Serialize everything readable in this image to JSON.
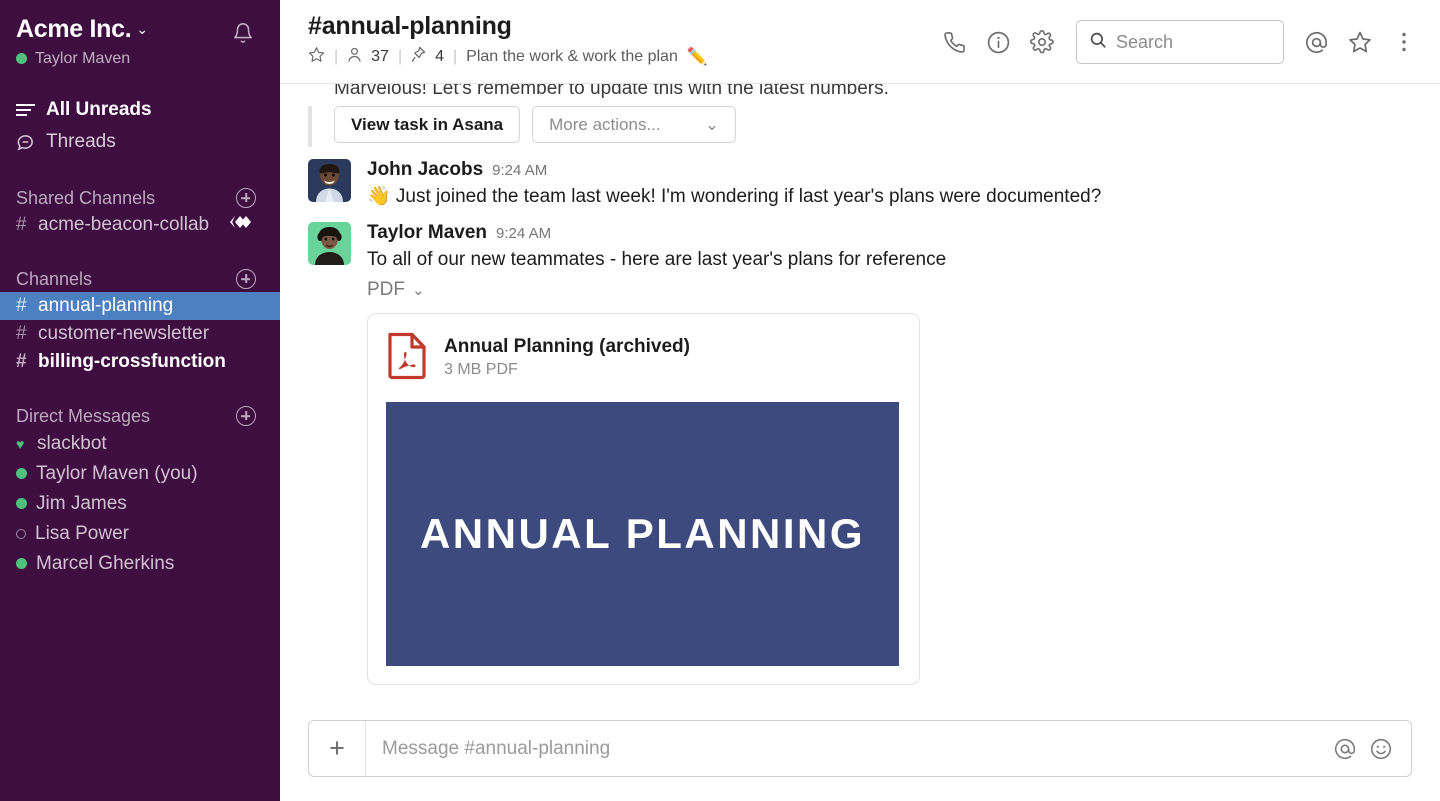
{
  "sidebar": {
    "team_name": "Acme Inc.",
    "caret": "⌄",
    "user_name": "Taylor Maven",
    "bell_icon": "notifications-bell-icon",
    "nav": [
      {
        "label": "All Unreads",
        "icon": "unreads-lines-icon",
        "bold": true
      },
      {
        "label": "Threads",
        "icon": "threads-bubble-icon",
        "bold": false
      }
    ],
    "shared_channels": {
      "title": "Shared Channels",
      "add_label": "+",
      "items": [
        {
          "name": "acme-beacon-collab",
          "hash": "#",
          "shared": true,
          "bold": false
        }
      ]
    },
    "channels": {
      "title": "Channels",
      "add_label": "+",
      "items": [
        {
          "name": "annual-planning",
          "hash": "#",
          "active": true,
          "bold": false
        },
        {
          "name": "customer-newsletter",
          "hash": "#",
          "active": false,
          "bold": false
        },
        {
          "name": "billing-crossfunction",
          "hash": "#",
          "active": false,
          "bold": true
        }
      ]
    },
    "direct_messages": {
      "title": "Direct Messages",
      "add_label": "+",
      "items": [
        {
          "name": "slackbot",
          "presence": "heart"
        },
        {
          "name": "Taylor Maven (you)",
          "presence": "online"
        },
        {
          "name": "Jim James",
          "presence": "online"
        },
        {
          "name": "Lisa Power",
          "presence": "away"
        },
        {
          "name": "Marcel Gherkins",
          "presence": "online"
        }
      ]
    }
  },
  "header": {
    "channel_title": "#annual-planning",
    "star_icon": "star-outline-icon",
    "member_icon": "member-person-icon",
    "member_count": "37",
    "pin_icon": "pin-icon",
    "pin_count": "4",
    "topic": "Plan the work & work the plan",
    "topic_emoji": "✏️",
    "separator": "|",
    "icons": {
      "call": "phone-call-icon",
      "info": "info-circle-icon",
      "settings": "gear-icon",
      "mentions": "at-mention-icon",
      "starred": "star-outline-icon",
      "more": "kebab-more-icon"
    },
    "search": {
      "placeholder": "Search",
      "icon": "search-magnifier-icon"
    }
  },
  "messages": {
    "truncated_top_text": "Marvelous! Let's remember to update this with the latest numbers.",
    "attachment_actions": {
      "primary_label": "View task in Asana",
      "select_label": "More actions...",
      "select_caret": "⌄"
    },
    "list": [
      {
        "author": "John Jacobs",
        "time": "9:24 AM",
        "text": "👋 Just joined the team last week! I'm wondering if last year's plans were documented?",
        "avatar_name": "avatar-john-jacobs"
      },
      {
        "author": "Taylor Maven",
        "time": "9:24 AM",
        "text": "To all of our new teammates - here are last year's plans for reference",
        "avatar_name": "avatar-taylor-maven",
        "file_type_label": "PDF",
        "file_type_caret": "⌄",
        "file": {
          "name": "Annual Planning (archived)",
          "meta": "3 MB PDF",
          "icon": "pdf-file-icon",
          "preview_text": "ANNUAL PLANNING",
          "preview_bg": "#3c4a7d"
        }
      }
    ]
  },
  "composer": {
    "plus_label": "+",
    "placeholder": "Message #annual-planning",
    "value": "",
    "mention_icon": "at-mention-icon",
    "emoji_icon": "smiley-emoji-icon"
  },
  "colors": {
    "sidebar_bg": "#3f0e40",
    "active_channel_bg": "#4d80c0",
    "presence_online": "#4ec17c",
    "pdf_red": "#c0392b",
    "preview_navy": "#3c4a7d"
  }
}
